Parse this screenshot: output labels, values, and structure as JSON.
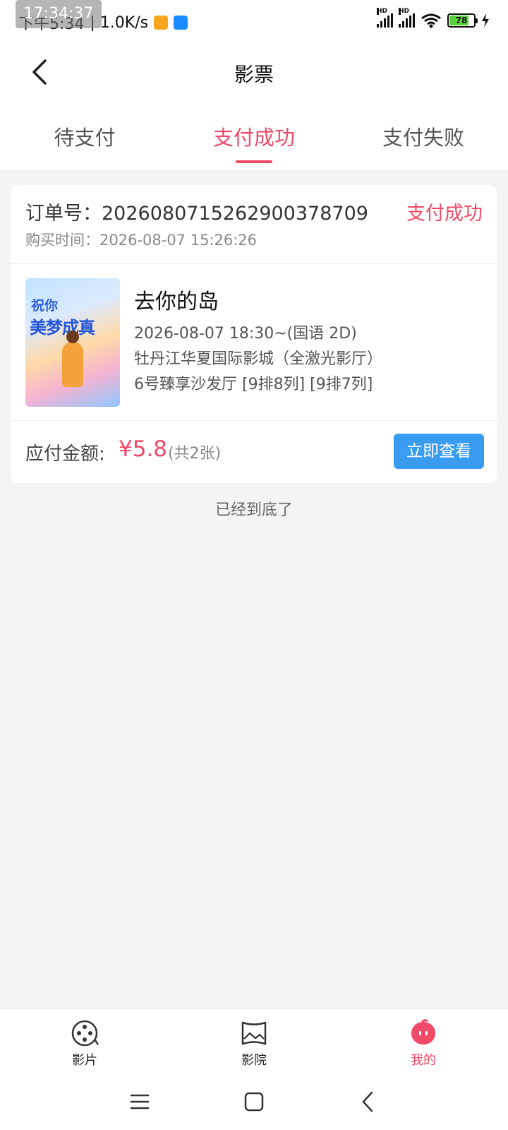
{
  "status_bar": {
    "time_text": "下午5:34",
    "speed": "| 1.0K/s",
    "overlay_time": "17:34:37",
    "battery": "78",
    "network": [
      "HD",
      "HD"
    ]
  },
  "header": {
    "title": "影票"
  },
  "tabs": [
    {
      "label": "待支付",
      "active": false
    },
    {
      "label": "支付成功",
      "active": true
    },
    {
      "label": "支付失败",
      "active": false
    }
  ],
  "order": {
    "order_no": "订单号：2026080715262900378709",
    "status": "支付成功",
    "buy_time": "购买时间：2026-08-07 15:26:26",
    "poster": {
      "line1": "祝你",
      "line2": "美梦成真"
    },
    "movie_name": "去你的岛",
    "showtime": "2026-08-07 18:30~(国语 2D)",
    "cinema": "牡丹江华夏国际影城（全激光影厅）",
    "seats": "6号臻享沙发厅 [9排8列] [9排7列]",
    "due_label": "应付金额:",
    "due_amount": "¥5.8",
    "ticket_count": "(共2张)",
    "view_button": "立即查看"
  },
  "end_text": "已经到底了",
  "bottom_nav": [
    {
      "label": "影片",
      "icon": "film-reel-icon",
      "active": false
    },
    {
      "label": "影院",
      "icon": "cinema-screen-icon",
      "active": false
    },
    {
      "label": "我的",
      "icon": "profile-bubble-icon",
      "active": true
    }
  ],
  "colors": {
    "accent": "#ef4a67",
    "button_blue": "#3a9cf0",
    "background": "#f4f4f4"
  }
}
